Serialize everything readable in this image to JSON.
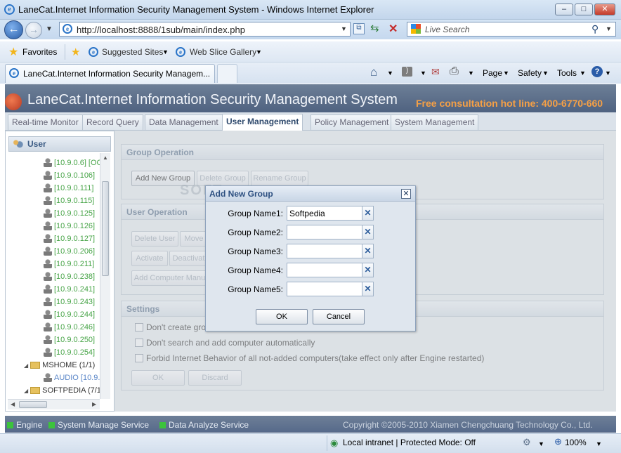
{
  "window": {
    "title": "LaneCat.Internet Information Security Management System - Windows Internet Explorer"
  },
  "browser": {
    "address": "http://localhost:8888/1sub/main/index.php",
    "search_placeholder": "Live Search",
    "favorites_label": "Favorites",
    "links": [
      "Suggested Sites",
      "Web Slice Gallery"
    ],
    "tab_title": "LaneCat.Internet Information Security Managem...",
    "commands": [
      "Page",
      "Safety",
      "Tools"
    ],
    "status_zone": "Local intranet | Protected Mode: Off",
    "zoom": "100%"
  },
  "app": {
    "name": "LaneCat.Internet Information Security Management System",
    "hotline": "Free consultation hot line: 400-6770-660",
    "tabs": [
      "Real-time Monitor",
      "Record Query",
      "Data Management",
      "User Management",
      "Policy Management",
      "System Management"
    ],
    "active_tab": "User Management",
    "sidebar": {
      "header": "User",
      "top_partial": "[10.9.0.6] [OC",
      "items": [
        "[10.9.0.106]",
        "[10.9.0.111]",
        "[10.9.0.115]",
        "[10.9.0.125]",
        "[10.9.0.126]",
        "[10.9.0.127]",
        "[10.9.0.206]",
        "[10.9.0.211]",
        "[10.9.0.238]",
        "[10.9.0.241]",
        "[10.9.0.243]",
        "[10.9.0.244]",
        "[10.9.0.246]",
        "[10.9.0.250]",
        "[10.9.0.254]"
      ],
      "folder1": "MSHOME (1/1)",
      "folder1_child": "AUDIO [10.9.",
      "folder2": "SOFTPEDIA (7/1"
    },
    "group_operation": {
      "title": "Group Operation",
      "buttons": [
        "Add New Group",
        "Delete Group",
        "Rename Group"
      ]
    },
    "user_operation": {
      "title": "User Operation",
      "buttons": [
        "Delete User",
        "Move",
        "Activate",
        "Deactivat",
        "Add Computer Manu"
      ]
    },
    "settings": {
      "title": "Settings",
      "options": [
        "Don't create grou",
        "Don't search and add computer automatically",
        "Forbid Internet Behavior of all not-added computers(take effect only after Engine restarted)"
      ],
      "ok": "OK",
      "discard": "Discard"
    },
    "status": {
      "services": [
        "Engine",
        "System Manage Service",
        "Data Analyze Service"
      ],
      "copyright": "Copyright ©2005-2010 Xiamen Chengchuang Technology Co., Ltd."
    }
  },
  "dialog": {
    "title": "Add New Group",
    "fields": [
      {
        "label": "Group Name1:",
        "value": "Softpedia"
      },
      {
        "label": "Group Name2:",
        "value": ""
      },
      {
        "label": "Group Name3:",
        "value": ""
      },
      {
        "label": "Group Name4:",
        "value": ""
      },
      {
        "label": "Group Name5:",
        "value": ""
      }
    ],
    "ok": "OK",
    "cancel": "Cancel"
  },
  "colors": {
    "header_bg": "#5b6e8a",
    "hotline": "#f6a045",
    "tree_ip": "#47a447",
    "service_dot": "#3cc33c"
  }
}
